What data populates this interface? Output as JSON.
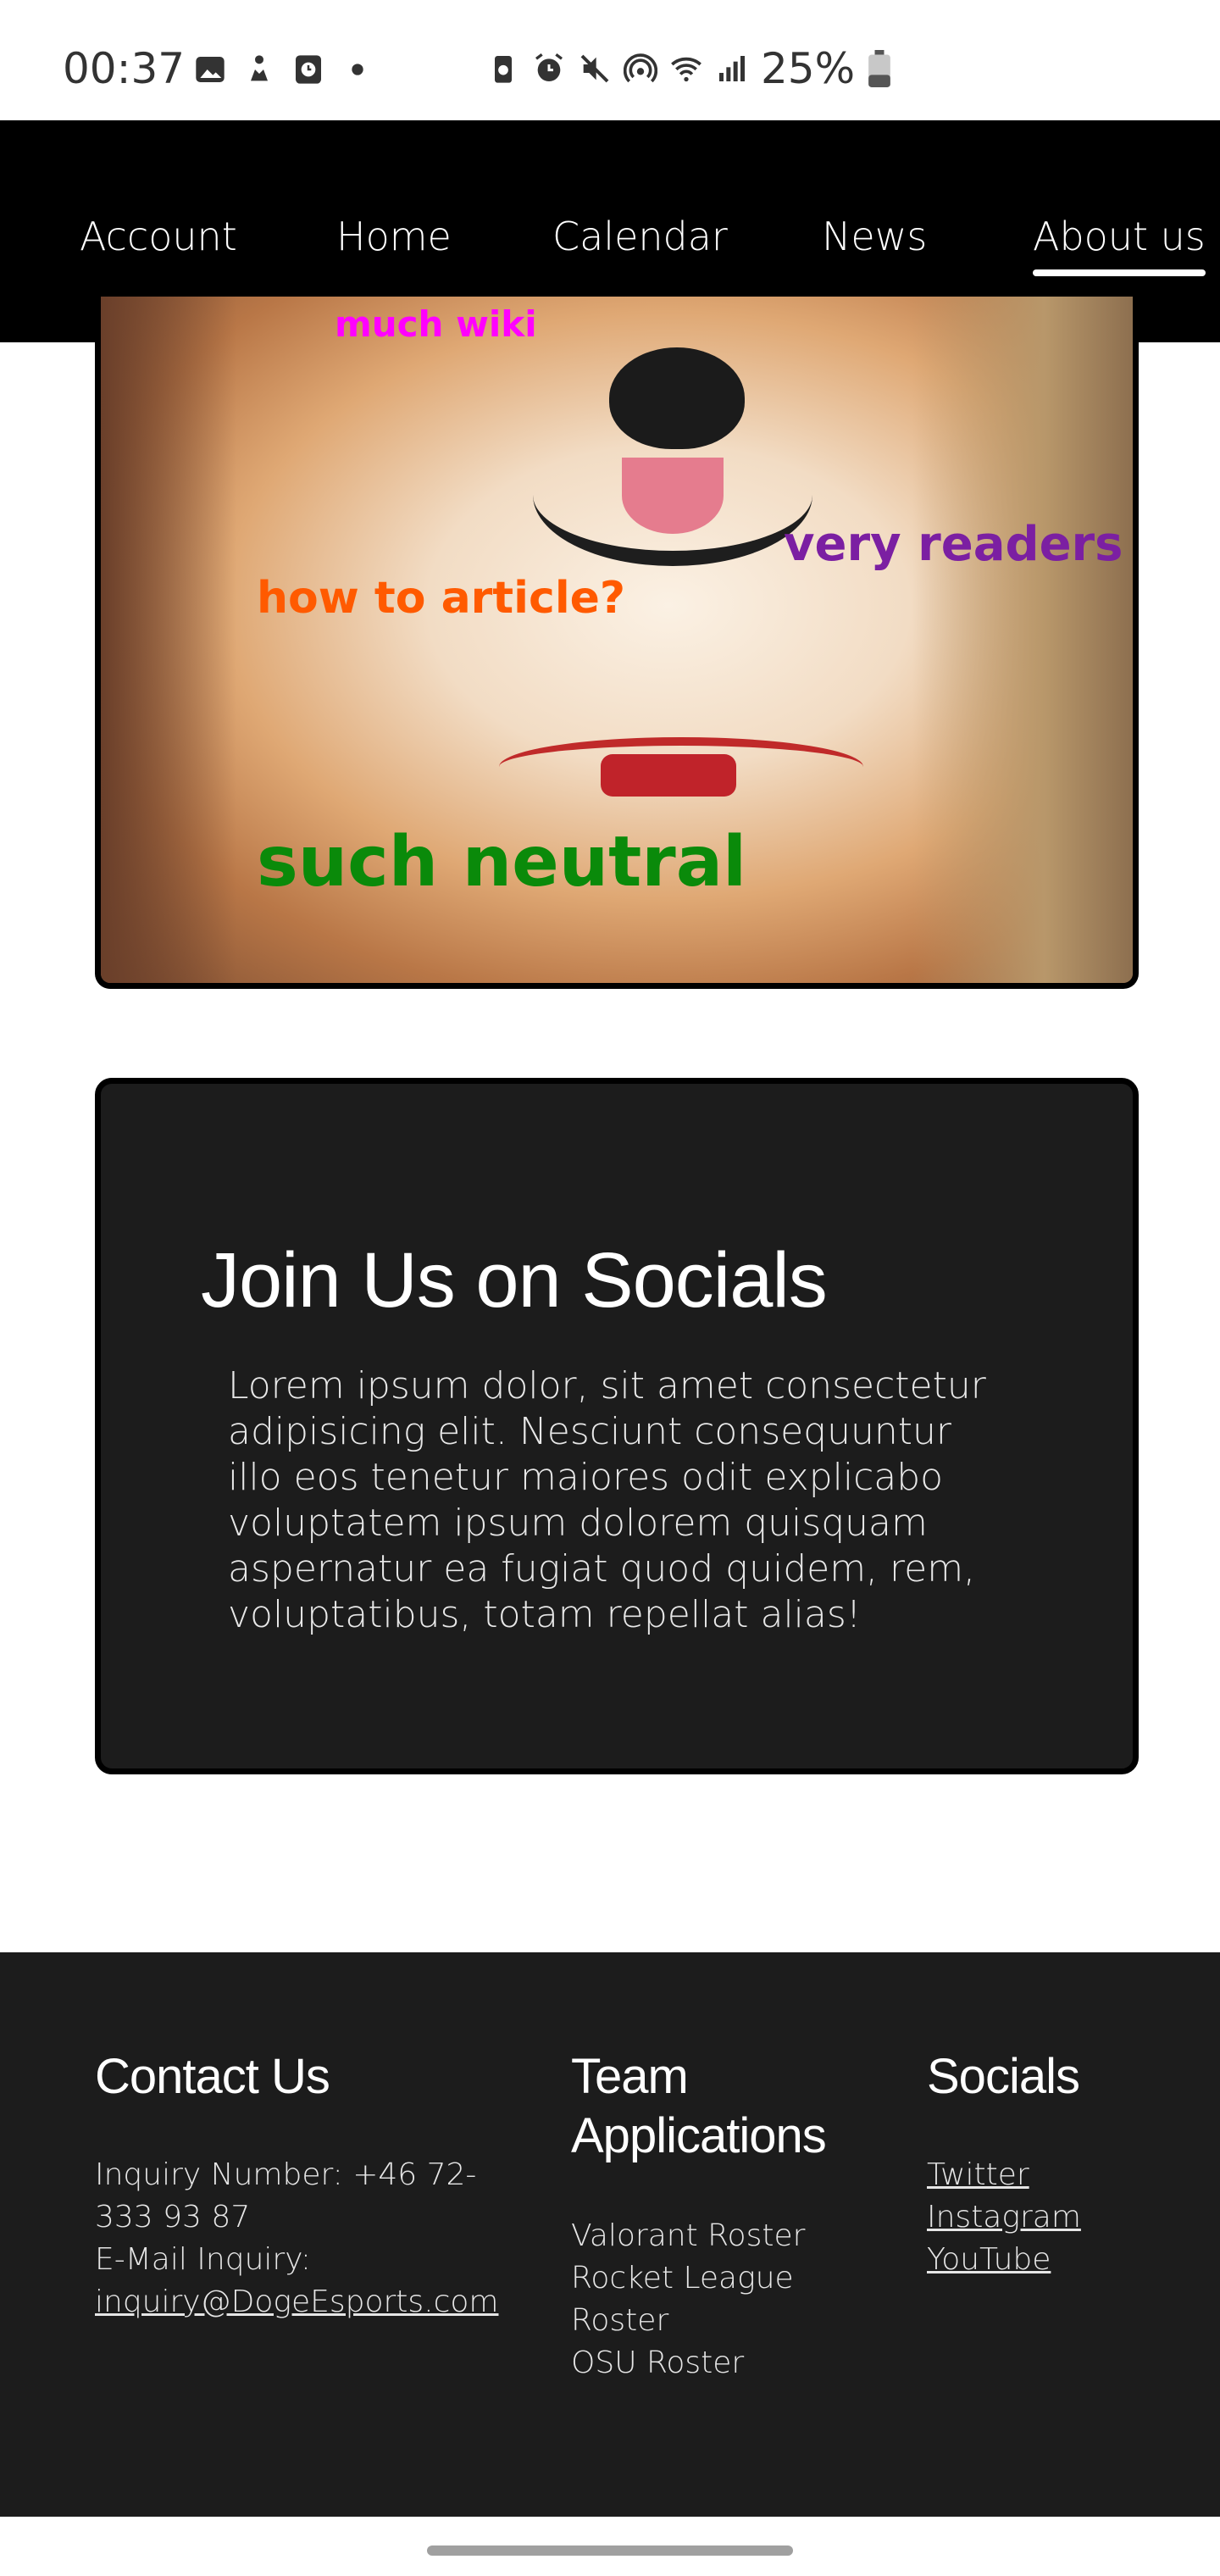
{
  "status_bar": {
    "time": "00:37",
    "battery": "25%",
    "icons_left": [
      "gallery-icon",
      "fitness-icon",
      "clock-app-icon",
      "dot-icon"
    ],
    "icons_right": [
      "battery-saver-icon",
      "alarm-icon",
      "mute-icon",
      "hotspot-icon",
      "wifi-icon",
      "signal-icon",
      "battery-icon"
    ]
  },
  "nav": {
    "items": [
      {
        "label": "Account"
      },
      {
        "label": "Home"
      },
      {
        "label": "Calendar"
      },
      {
        "label": "News"
      },
      {
        "label": "About us",
        "active": true
      }
    ]
  },
  "hero": {
    "captions": [
      {
        "text": "much wiki",
        "color": "#ff00ff"
      },
      {
        "text": "very readers",
        "color": "#7b1fa2"
      },
      {
        "text": "how to article?",
        "color": "#ff5a00"
      },
      {
        "text": "such neutral",
        "color": "#0a8a0a"
      }
    ]
  },
  "socials_card": {
    "title": "Join Us on Socials",
    "body": "Lorem ipsum dolor, sit amet consectetur adipisicing elit. Nesciunt consequuntur illo eos tenetur maiores odit explicabo voluptatem ipsum dolorem quisquam aspernatur ea fugiat quod quidem, rem, voluptatibus, totam repellat alias!"
  },
  "footer": {
    "contact": {
      "heading": "Contact Us",
      "phone_line_1": "Inquiry Number: +46 72-",
      "phone_line_2": "333 93 87",
      "email_label": "E-Mail Inquiry:",
      "email": "inquiry@DogeEsports.com"
    },
    "team": {
      "heading_line_1": "Team",
      "heading_line_2": "Applications",
      "rosters": [
        "Valorant Roster",
        "Rocket League",
        "Roster",
        "OSU Roster"
      ]
    },
    "socials": {
      "heading": "Socials",
      "links": [
        "Twitter",
        "Instagram",
        "YouTube"
      ]
    }
  },
  "colors": {
    "nav_bg": "#000000",
    "card_bg": "#1c1c1c",
    "footer_bg": "#1c1c1c",
    "text_light": "#ffffff"
  }
}
